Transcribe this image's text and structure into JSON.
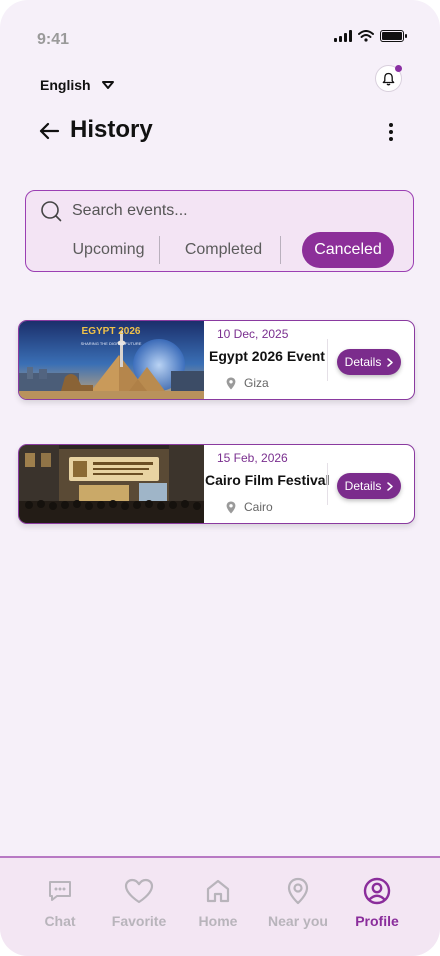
{
  "status_bar": {
    "time": "9:41"
  },
  "language": {
    "label": "English"
  },
  "header": {
    "title": "History"
  },
  "search": {
    "placeholder": "Search events..."
  },
  "tabs": [
    {
      "label": "Upcoming",
      "active": false
    },
    {
      "label": "Completed",
      "active": false
    },
    {
      "label": "Canceled",
      "active": true
    }
  ],
  "events": [
    {
      "date": "10 Dec, 2025",
      "title": "Egypt 2026 Event",
      "location": "Giza",
      "details_label": "Details",
      "image_text": "EGYPT 2026",
      "image_subtext": "SHARING THE DIGITAL FUTURE"
    },
    {
      "date": "15 Feb, 2026",
      "title": "Cairo Film Festival",
      "location": "Cairo",
      "details_label": "Details"
    }
  ],
  "bottom_nav": [
    {
      "label": "Chat",
      "icon": "chat-icon",
      "active": false
    },
    {
      "label": "Favorite",
      "icon": "heart-icon",
      "active": false
    },
    {
      "label": "Home",
      "icon": "home-icon",
      "active": false
    },
    {
      "label": "Near you",
      "icon": "location-pin-icon",
      "active": false
    },
    {
      "label": "Profile",
      "icon": "profile-icon",
      "active": true
    }
  ],
  "colors": {
    "accent": "#8c2f99",
    "background": "#f6f0f9",
    "inactive_nav": "#b8b4bb"
  }
}
